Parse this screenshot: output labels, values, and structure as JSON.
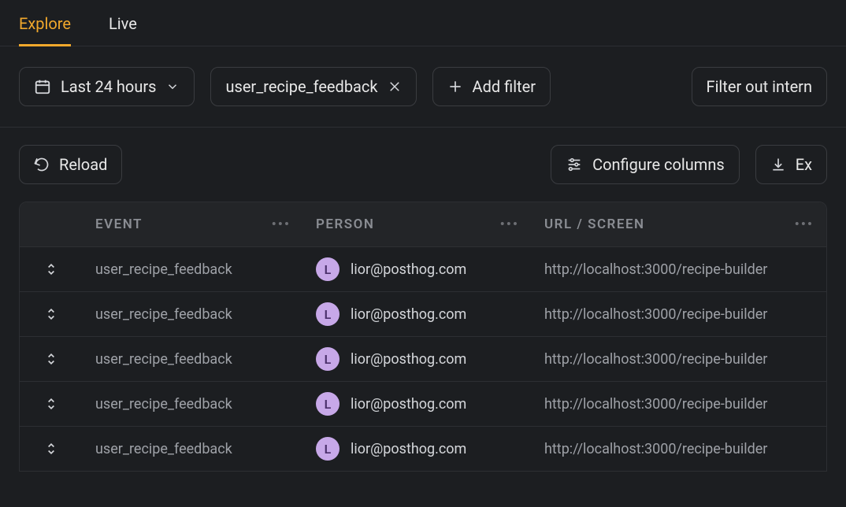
{
  "tabs": {
    "explore": "Explore",
    "live": "Live"
  },
  "filters": {
    "daterange": "Last 24 hours",
    "event_filter": "user_recipe_feedback",
    "add_filter": "Add filter",
    "internal_filter": "Filter out intern"
  },
  "actions": {
    "reload": "Reload",
    "configure": "Configure columns",
    "export": "Ex"
  },
  "columns": {
    "event": "EVENT",
    "person": "PERSON",
    "url": "URL / SCREEN"
  },
  "avatar_letter": "L",
  "rows": [
    {
      "event": "user_recipe_feedback",
      "person": "lior@posthog.com",
      "url": "http://localhost:3000/recipe-builder"
    },
    {
      "event": "user_recipe_feedback",
      "person": "lior@posthog.com",
      "url": "http://localhost:3000/recipe-builder"
    },
    {
      "event": "user_recipe_feedback",
      "person": "lior@posthog.com",
      "url": "http://localhost:3000/recipe-builder"
    },
    {
      "event": "user_recipe_feedback",
      "person": "lior@posthog.com",
      "url": "http://localhost:3000/recipe-builder"
    },
    {
      "event": "user_recipe_feedback",
      "person": "lior@posthog.com",
      "url": "http://localhost:3000/recipe-builder"
    }
  ]
}
